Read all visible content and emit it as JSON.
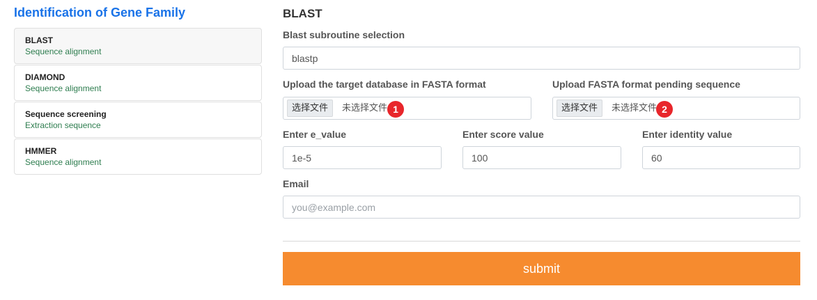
{
  "sidebar": {
    "title": "Identification of Gene Family",
    "items": [
      {
        "title": "BLAST",
        "subtitle": "Sequence alignment"
      },
      {
        "title": "DIAMOND",
        "subtitle": "Sequence alignment"
      },
      {
        "title": "Sequence screening",
        "subtitle": "Extraction sequence"
      },
      {
        "title": "HMMER",
        "subtitle": "Sequence alignment"
      }
    ]
  },
  "main": {
    "title": "BLAST",
    "subroutine": {
      "label": "Blast subroutine selection",
      "value": "blastp"
    },
    "upload_db": {
      "label": "Upload the target database in FASTA format",
      "button": "选择文件",
      "status": "未选择文件",
      "badge": "1"
    },
    "upload_seq": {
      "label": "Upload FASTA format pending sequence",
      "button": "选择文件",
      "status": "未选择文件",
      "badge": "2"
    },
    "evalue": {
      "label": "Enter e_value",
      "value": "1e-5"
    },
    "score": {
      "label": "Enter score value",
      "value": "100"
    },
    "identity": {
      "label": "Enter identity value",
      "value": "60"
    },
    "email": {
      "label": "Email",
      "placeholder": "you@example.com"
    },
    "submit_label": "submit"
  },
  "colors": {
    "title_blue": "#1a73e8",
    "subtitle_green": "#2e7d4f",
    "submit_orange": "#f68b2f",
    "badge_red": "#e8262b"
  }
}
